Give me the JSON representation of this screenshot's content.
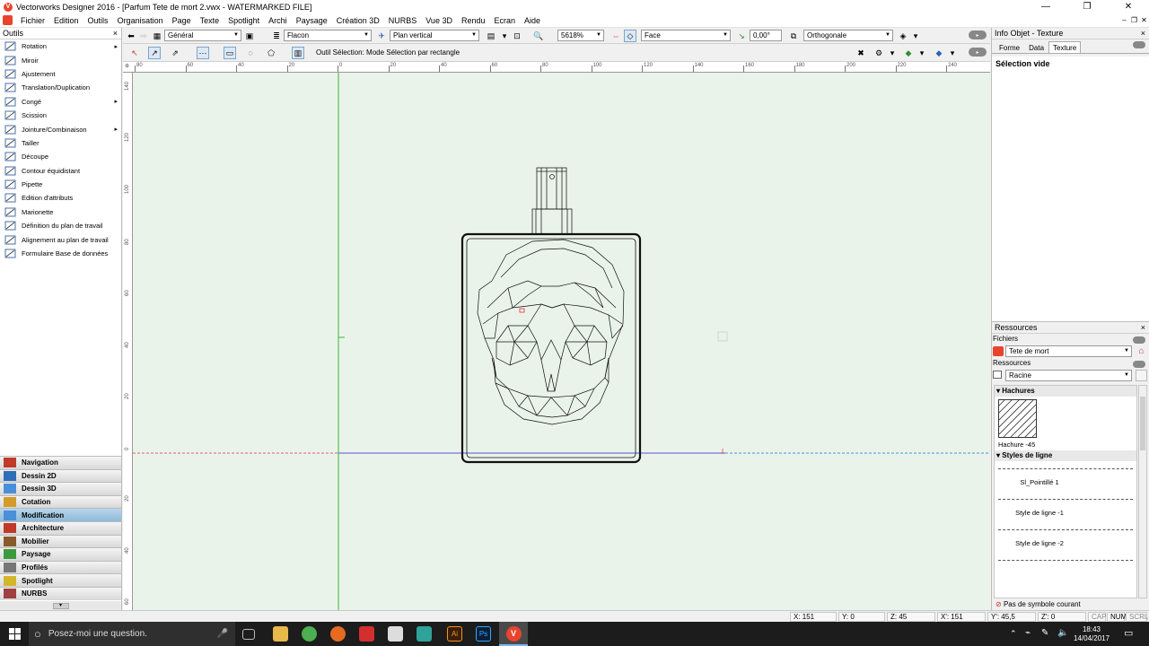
{
  "window": {
    "title": "Vectorworks Designer 2016 - [Parfum Tete de mort 2.vwx - WATERMARKED FILE]",
    "controls": [
      "—",
      "❐",
      "✕"
    ],
    "mdi_controls": [
      "–",
      "❐",
      "✕"
    ]
  },
  "menu": [
    "Fichier",
    "Edition",
    "Outils",
    "Organisation",
    "Page",
    "Texte",
    "Spotlight",
    "Archi",
    "Paysage",
    "Création 3D",
    "NURBS",
    "Vue 3D",
    "Rendu",
    "Ecran",
    "Aide"
  ],
  "tools_panel": {
    "title": "Outils",
    "close": "×",
    "items": [
      {
        "label": "Rotation",
        "icon": "rotate-icon",
        "has_submenu": true
      },
      {
        "label": "Miroir",
        "icon": "mirror-icon",
        "has_submenu": false
      },
      {
        "label": "Ajustement",
        "icon": "fit-icon",
        "has_submenu": false
      },
      {
        "label": "Translation/Duplication",
        "icon": "move-icon",
        "has_submenu": false
      },
      {
        "label": "Congé",
        "icon": "fillet-icon",
        "has_submenu": true
      },
      {
        "label": "Scission",
        "icon": "split-icon",
        "has_submenu": false
      },
      {
        "label": "Jointure/Combinaison",
        "icon": "join-icon",
        "has_submenu": true
      },
      {
        "label": "Tailler",
        "icon": "trim-icon",
        "has_submenu": false
      },
      {
        "label": "Découpe",
        "icon": "clip-icon",
        "has_submenu": false
      },
      {
        "label": "Contour équidistant",
        "icon": "offset-icon",
        "has_submenu": false
      },
      {
        "label": "Pipette",
        "icon": "eyedropper-icon",
        "has_submenu": false
      },
      {
        "label": "Edition d'attributs",
        "icon": "attributes-icon",
        "has_submenu": false
      },
      {
        "label": "Marionette",
        "icon": "reshape-icon",
        "has_submenu": false
      },
      {
        "label": "Définition du plan de travail",
        "icon": "workplane-icon",
        "has_submenu": false
      },
      {
        "label": "Alignement au plan de travail",
        "icon": "align-plane-icon",
        "has_submenu": false
      },
      {
        "label": "Formulaire Base de données",
        "icon": "database-icon",
        "has_submenu": false
      }
    ]
  },
  "palettes": [
    {
      "label": "Navigation",
      "color": "#c0392b"
    },
    {
      "label": "Dessin 2D",
      "color": "#2e6fb7"
    },
    {
      "label": "Dessin 3D",
      "color": "#4a90d9"
    },
    {
      "label": "Cotation",
      "color": "#d49b2a"
    },
    {
      "label": "Modification",
      "color": "#4a90d9"
    },
    {
      "label": "Architecture",
      "color": "#c0392b"
    },
    {
      "label": "Mobilier",
      "color": "#8b5a2b"
    },
    {
      "label": "Paysage",
      "color": "#3c9a3c"
    },
    {
      "label": "Profilés",
      "color": "#777777"
    },
    {
      "label": "Spotlight",
      "color": "#d4b62a"
    },
    {
      "label": "NURBS",
      "color": "#a04040"
    }
  ],
  "active_palette": "Modification",
  "view_bar": {
    "class": "Général",
    "layer": "Flacon",
    "view_plane": "Plan vertical",
    "zoom": "5618%",
    "render": "Face",
    "angle": "0,00°",
    "projection": "Orthogonale"
  },
  "mode_bar": {
    "message": "Outil Sélection: Mode Sélection par rectangle"
  },
  "hruler_labels": [
    "80",
    "60",
    "40",
    "20",
    "0",
    "20",
    "40",
    "60",
    "80",
    "100",
    "120",
    "140",
    "160",
    "180",
    "200",
    "220",
    "240"
  ],
  "vruler_labels": [
    "140",
    "120",
    "100",
    "80",
    "60",
    "40",
    "20",
    "0",
    "20",
    "40",
    "60"
  ],
  "info_panel": {
    "title": "Info Objet - Texture",
    "tabs": [
      "Forme",
      "Data",
      "Texture"
    ],
    "selected_tab": "Texture",
    "status": "Sélection vide"
  },
  "resources_panel": {
    "title": "Ressources",
    "files_label": "Fichiers",
    "file": "Tete de mort",
    "resources_label": "Ressources",
    "folder": "Racine",
    "sections": [
      {
        "title": "Hachures",
        "items": [
          "Hachure -45"
        ]
      },
      {
        "title": "Styles de ligne",
        "items": [
          "Sl_Pointillé 1",
          "Style de ligne -1",
          "Style de ligne -2"
        ]
      }
    ],
    "footer": "Pas de symbole courant"
  },
  "status_bar": {
    "x": "X:  151",
    "y": "Y:  0",
    "z": "Z:  45",
    "x2": "X':  151",
    "y2": "Y':  45,5",
    "z2": "Z':  0",
    "keys": [
      "CAP",
      "NUM",
      "SCRL"
    ]
  },
  "taskbar": {
    "search_placeholder": "Posez-moi une question.",
    "time": "18:43",
    "date": "14/04/2017"
  },
  "colors": {
    "canvas": "#eaf3ea",
    "accent": "#e8442d",
    "active_palette": "#9fc4e0"
  }
}
